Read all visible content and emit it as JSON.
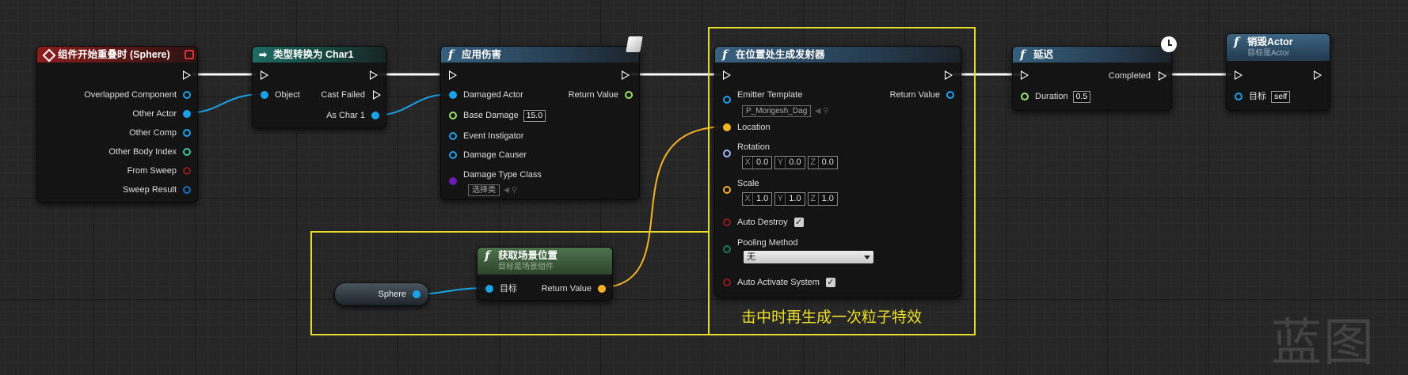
{
  "comment": {
    "text": "击中时再生成一次粒子特效"
  },
  "watermark": "蓝图",
  "nodes": {
    "overlap": {
      "title": "组件开始重叠时 (Sphere)",
      "pins": [
        "Overlapped Component",
        "Other Actor",
        "Other Comp",
        "Other Body Index",
        "From Sweep",
        "Sweep Result"
      ]
    },
    "cast": {
      "title": "类型转换为 Char1",
      "in_pins": [
        "Object"
      ],
      "out_pins": [
        "Cast Failed",
        "As Char 1"
      ]
    },
    "damage": {
      "title": "应用伤害",
      "pins": [
        "Damaged Actor",
        "Base Damage",
        "Event Instigator",
        "Damage Causer",
        "Damage Type Class"
      ],
      "base_damage_value": "15.0",
      "damage_type_value": "选择类",
      "return_label": "Return Value"
    },
    "spawn": {
      "title": "在位置处生成发射器",
      "return_label": "Return Value",
      "emitter_label": "Emitter Template",
      "emitter_value": "P_Morigesh_Dag",
      "location_label": "Location",
      "rotation_label": "Rotation",
      "rotation": {
        "x": "0.0",
        "y": "0.0",
        "z": "0.0"
      },
      "scale_label": "Scale",
      "scale": {
        "x": "1.0",
        "y": "1.0",
        "z": "1.0"
      },
      "auto_destroy_label": "Auto Destroy",
      "pooling_label": "Pooling Method",
      "pooling_value": "无",
      "auto_activate_label": "Auto Activate System"
    },
    "delay": {
      "title": "延迟",
      "completed_label": "Completed",
      "duration_label": "Duration",
      "duration_value": "0.5"
    },
    "destroy": {
      "title": "销毁Actor",
      "subtitle": "目标是Actor",
      "target_label": "目标",
      "target_value": "self"
    },
    "getloc": {
      "title": "获取场景位置",
      "subtitle": "目标是场景组件",
      "target_label": "目标",
      "return_label": "Return Value"
    },
    "sphere_var": {
      "label": "Sphere"
    }
  },
  "axis_letters": {
    "x": "X",
    "y": "Y",
    "z": "Z"
  },
  "colors": {
    "exec": "#ffffff",
    "object_pin": "#1aa3e8",
    "vector_pin": "#f5b324",
    "float_pin": "#9be36a",
    "rotator_pin": "#9fb3ff",
    "bool_pin": "#8b1a1a",
    "int_pin": "#37c9a0",
    "class_pin": "#6a1fb0",
    "comment": "#e8dc2a"
  }
}
